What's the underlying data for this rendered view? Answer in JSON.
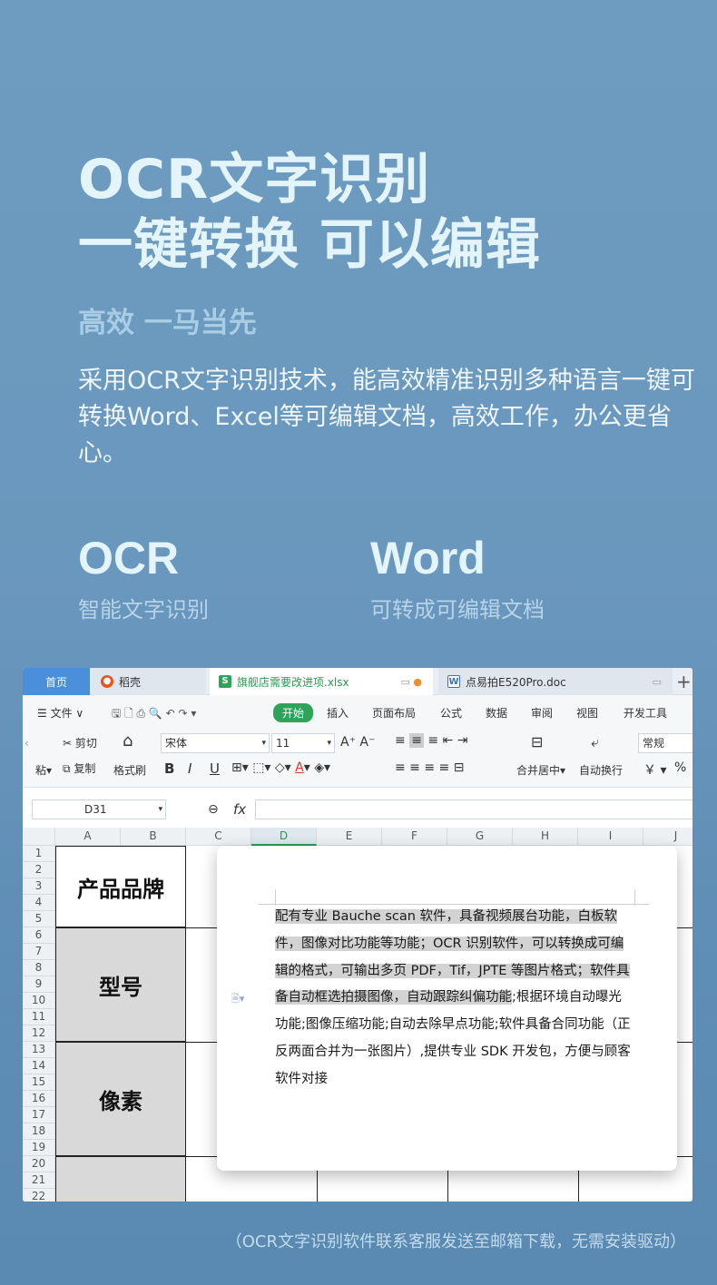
{
  "hero": {
    "title_line1": "OCR文字识别",
    "title_line2": "一键转换 可以编辑",
    "subtitle": "高效 一马当先",
    "description": "采用OCR文字识别技术，能高效精准识别多种语言一键可转换Word、Excel等可编辑文档，高效工作，办公更省心。"
  },
  "features": [
    {
      "big": "OCR",
      "small": "智能文字识别"
    },
    {
      "big": "Word",
      "small": "可转成可编辑文档"
    }
  ],
  "app": {
    "tabs": {
      "home": "首页",
      "daoke": "稻壳",
      "xlsx": "旗舰店需要改进项.xlsx",
      "doc": "点易拍E520Pro.doc",
      "plus": "+"
    },
    "menu": {
      "file": "文件",
      "start": "开始",
      "insert": "插入",
      "layout": "页面布局",
      "formula": "公式",
      "data": "数据",
      "review": "审阅",
      "view": "视图",
      "dev": "开发工具"
    },
    "ribbon": {
      "cut": "剪切",
      "paste": "粘",
      "copy": "复制",
      "format_painter": "格式刷",
      "font_name": "宋体",
      "font_size": "11",
      "merge_center": "合并居中",
      "wrap": "自动换行",
      "number_format": "常规",
      "currency": "￥",
      "percent": "%"
    },
    "formula_bar": {
      "cell_ref": "D31",
      "fx": "fx"
    },
    "columns": [
      "A",
      "B",
      "C",
      "D",
      "E",
      "F",
      "G",
      "H",
      "I",
      "J"
    ],
    "rows": [
      "1",
      "2",
      "3",
      "4",
      "5",
      "6",
      "7",
      "8",
      "9",
      "10",
      "11",
      "12",
      "13",
      "14",
      "15",
      "16",
      "17",
      "18",
      "19",
      "20",
      "21",
      "22"
    ],
    "merged_cells": [
      "产品品牌",
      "型号",
      "像素"
    ],
    "document": {
      "text_highlighted": "配有专业 Bauche scan 软件，具备视频展台功能，白板软件，图像对比功能等功能；OCR 识别软件，可以转换成可编辑的格式，可输出多页 PDF，Tif，JPTE 等图片格式；软件具备自动框选拍摄图像，自动跟踪纠偏功能",
      "text_normal": ";根据环境自动曝光功能;图像压缩功能;自动去除早点功能;软件具备合同功能（正反两面合并为一张图片）,提供专业 SDK 开发包，方便与顾客软件对接"
    }
  },
  "footer_note": "（OCR文字识别软件联系客服发送至邮箱下载，无需安装驱动）"
}
